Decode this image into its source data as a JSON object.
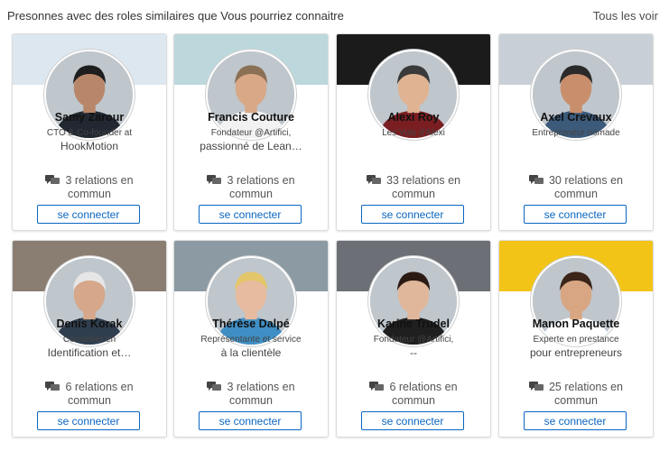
{
  "header": {
    "title": "Presonnes avec des roles similaires que Vous pourriez connaitre",
    "see_all": "Tous les voir"
  },
  "cards": [
    {
      "name": "Samy Zarour",
      "subtitle_lines": [
        "CTO & Co-founder at",
        "HookMotion"
      ],
      "relations": [
        "3 relations en",
        "commun"
      ],
      "button": "se connecter",
      "banner_color": "#dde7ef",
      "skin": "#b8876a",
      "hair": "#1e1e1e",
      "shirt": "#222831"
    },
    {
      "name": "Francis Couture",
      "subtitle_lines": [
        "Fondateur @Artifici,",
        "passionné de Lean…"
      ],
      "relations": [
        "3 relations en",
        "commun"
      ],
      "button": "se connecter",
      "banner_color": "#bcd8dc",
      "skin": "#d9a886",
      "hair": "#8a7055",
      "shirt": "#f2f2f2"
    },
    {
      "name": "Alexi Roy",
      "subtitle_lines": [
        "Les Vols d'Alexi"
      ],
      "relations": [
        "33 relations en",
        "commun"
      ],
      "button": "se connecter",
      "banner_color": "#1b1b1b",
      "skin": "#e0b392",
      "hair": "#3a3a3a",
      "shirt": "#7a1e22"
    },
    {
      "name": "Axel Crevaux",
      "subtitle_lines": [
        "Entrepreneur nomade"
      ],
      "relations": [
        "30 relations en",
        "commun"
      ],
      "button": "se connecter",
      "banner_color": "#c9cfd6",
      "skin": "#c98f6c",
      "hair": "#2a2a2a",
      "shirt": "#3c5a7a"
    },
    {
      "name": "Denis Korak",
      "subtitle_lines": [
        "Conseiller en",
        "Identification et…"
      ],
      "relations": [
        "6 relations en",
        "commun"
      ],
      "button": "se connecter",
      "banner_color": "#8a7d72",
      "skin": "#d6a78a",
      "hair": "#e6e6e6",
      "shirt": "#2f3e4e"
    },
    {
      "name": "Thérèse Dalpé",
      "subtitle_lines": [
        "Représentante et service",
        "à la clientèle"
      ],
      "relations": [
        "3 relations en",
        "commun"
      ],
      "button": "se connecter",
      "banner_color": "#8c9aa3",
      "skin": "#e6bba0",
      "hair": "#e3c56a",
      "shirt": "#3f8fc4"
    },
    {
      "name": "Karine Trudel",
      "subtitle_lines": [
        "Fondateur @Artifici,",
        "--"
      ],
      "relations": [
        "6 relations en",
        "commun"
      ],
      "button": "se connecter",
      "banner_color": "#6c6f75",
      "skin": "#e0b79a",
      "hair": "#2b1a14",
      "shirt": "#1f1f1f"
    },
    {
      "name": "Manon Paquette",
      "subtitle_lines": [
        "Experte en prestance",
        "pour entrepreneurs"
      ],
      "relations": [
        "25 relations en",
        "commun"
      ],
      "button": "se connecter",
      "banner_color": "#f2c418",
      "skin": "#d9a683",
      "hair": "#3b2418",
      "shirt": "#ffffff"
    }
  ]
}
